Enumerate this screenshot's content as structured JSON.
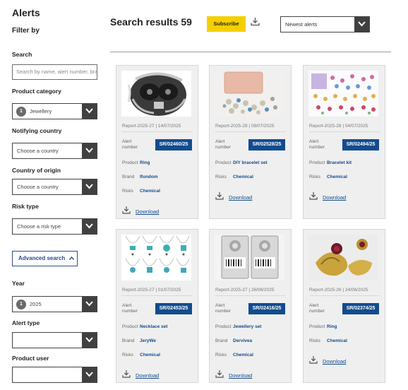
{
  "sidebar": {
    "title": "Alerts",
    "filter_by": "Filter by",
    "search": {
      "label": "Search",
      "placeholder": "Search by name, alert number, brand"
    },
    "product_category": {
      "label": "Product category",
      "badge": "1",
      "value": "Jewellery"
    },
    "notifying_country": {
      "label": "Notifying country",
      "value": "Choose a country"
    },
    "country_of_origin": {
      "label": "Country of origin",
      "value": "Choose a country"
    },
    "risk_type": {
      "label": "Risk type",
      "value": "Choose a risk type"
    },
    "advanced_search": "Advanced search",
    "year": {
      "label": "Year",
      "badge": "1",
      "value": "2025"
    },
    "alert_type": {
      "label": "Alert type",
      "value": ""
    },
    "product_user": {
      "label": "Product user",
      "value": ""
    }
  },
  "header": {
    "results_title": "Search results 59",
    "subscribe": "Subscribe",
    "sort_value": "Newest alerts"
  },
  "labels": {
    "alert_number": "Alert number",
    "product": "Product",
    "brand": "Brand",
    "risks": "Risks",
    "download": "Download"
  },
  "cards": [
    {
      "report": "Report-2025-27 | 14/07/2025",
      "alert": "SR/02460/25",
      "product": "Ring",
      "brand": "Ifundom",
      "risks": "Chemical",
      "image": "skull-ring"
    },
    {
      "report": "Report-2025-28 | 08/07/2025",
      "alert": "SR/02528/25",
      "product": "DIY bracelet set",
      "risks": "Chemical",
      "image": "diy-bracelet"
    },
    {
      "report": "Report-2025-28 | 04/07/2025",
      "alert": "SR/02494/25",
      "product": "Bracelet kit",
      "risks": "Chemical",
      "image": "bracelet-kit"
    },
    {
      "report": "Report-2025-27 | 01/07/2025",
      "alert": "SR/02453/25",
      "product": "Necklace set",
      "brand": "JeryWe",
      "risks": "Chemical",
      "image": "necklaces"
    },
    {
      "report": "Report-2025-27 | 26/06/2025",
      "alert": "SR/02416/25",
      "product": "Jewellery set",
      "brand": "Dervivea",
      "risks": "Chemical",
      "image": "jewellery-set"
    },
    {
      "report": "Report-2025-26 | 24/06/2025",
      "alert": "SR/02374/25",
      "product": "Ring",
      "risks": "Chemical",
      "image": "gold-rings"
    }
  ],
  "colors": {
    "accent_blue": "#124c8e",
    "subscribe_yellow": "#f5d000",
    "dark_gray": "#404040"
  }
}
